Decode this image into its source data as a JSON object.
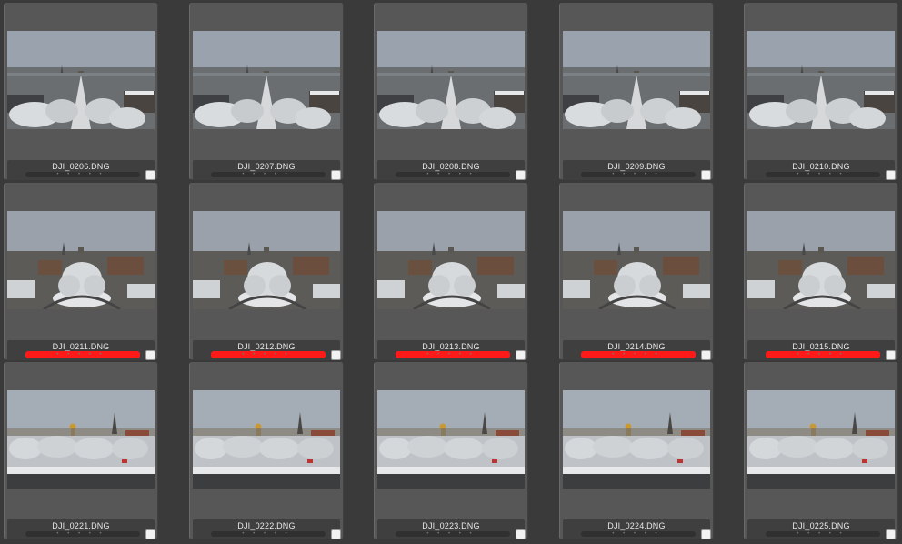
{
  "app": {
    "view": "thumbnail grid",
    "rating_glyphs": "• • • • •"
  },
  "colors": {
    "background": "#3a3a3a",
    "cell": "#575757",
    "label_red": "#ff1a1a",
    "text": "#e8e8e8"
  },
  "rows": [
    {
      "scene": "campus-quad-aerial",
      "items": [
        {
          "filename": "DJI_0206.DNG",
          "color_label": "none",
          "selected": false
        },
        {
          "filename": "DJI_0207.DNG",
          "color_label": "none",
          "selected": false
        },
        {
          "filename": "DJI_0208.DNG",
          "color_label": "none",
          "selected": false
        },
        {
          "filename": "DJI_0209.DNG",
          "color_label": "none",
          "selected": false
        },
        {
          "filename": "DJI_0210.DNG",
          "color_label": "none",
          "selected": false
        }
      ]
    },
    {
      "scene": "circular-plaza-aerial",
      "items": [
        {
          "filename": "DJI_0211.DNG",
          "color_label": "red",
          "selected": false
        },
        {
          "filename": "DJI_0212.DNG",
          "color_label": "red",
          "selected": false
        },
        {
          "filename": "DJI_0213.DNG",
          "color_label": "red",
          "selected": false
        },
        {
          "filename": "DJI_0214.DNG",
          "color_label": "red",
          "selected": false
        },
        {
          "filename": "DJI_0215.DNG",
          "color_label": "red",
          "selected": false
        }
      ]
    },
    {
      "scene": "golden-dome-skyline",
      "items": [
        {
          "filename": "DJI_0221.DNG",
          "color_label": "none",
          "selected": false
        },
        {
          "filename": "DJI_0222.DNG",
          "color_label": "none",
          "selected": false
        },
        {
          "filename": "DJI_0223.DNG",
          "color_label": "none",
          "selected": false
        },
        {
          "filename": "DJI_0224.DNG",
          "color_label": "none",
          "selected": false
        },
        {
          "filename": "DJI_0225.DNG",
          "color_label": "none",
          "selected": false
        }
      ]
    }
  ]
}
